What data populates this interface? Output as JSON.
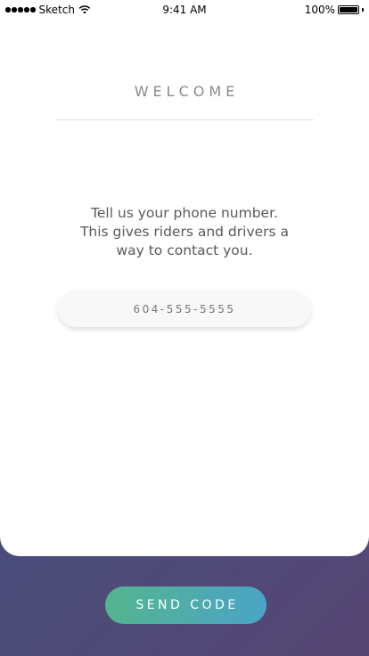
{
  "status_bar": {
    "carrier": "Sketch",
    "time": "9:41 AM",
    "battery": "100%",
    "icons": [
      "signal-dots-icon",
      "wifi-icon",
      "battery-icon"
    ]
  },
  "header": {
    "title": "WELCOME"
  },
  "main": {
    "instruction_line1": "Tell us your phone number.",
    "instruction_line2": "This gives riders and drivers a",
    "instruction_line3": "way to contact you.",
    "phone_placeholder": "604-555-5555"
  },
  "footer": {
    "send_label": "SEND CODE"
  },
  "colors": {
    "button_gradient_start": "#53b58e",
    "button_gradient_end": "#4aa4c7",
    "background_start": "#3f5a85",
    "background_end": "#564674",
    "card": "#ffffff"
  }
}
